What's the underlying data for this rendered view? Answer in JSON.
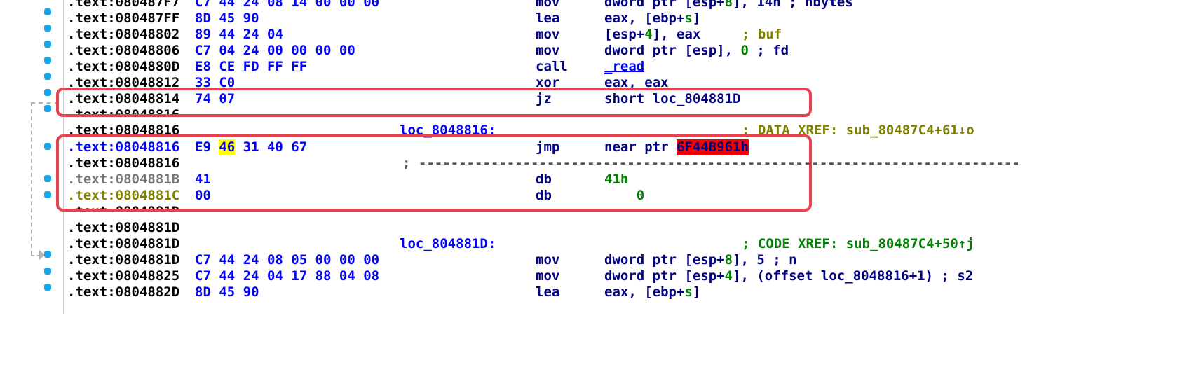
{
  "colors": {
    "address": "#000000",
    "bytes": "#0000ff",
    "mnemonic": "#000080",
    "comment": "#808000",
    "number": "#008000",
    "highlight_box": "#e8424f",
    "breakpoint_dot": "#19a6e8"
  },
  "lines": [
    {
      "addr": ".text:080487F7",
      "bytes": "C7 44 24 08 14 00 00 00",
      "label": "",
      "mnemonic": "mov",
      "operand_pre": "dword ptr [esp+",
      "operand_num": "8",
      "operand_post": "], 14h ; nbytes",
      "comment": ""
    },
    {
      "addr": ".text:080487FF",
      "bytes": "8D 45 90",
      "label": "",
      "mnemonic": "lea",
      "operand_pre": "eax, [ebp+",
      "operand_num": "s",
      "operand_post": "]",
      "comment": ""
    },
    {
      "addr": ".text:08048802",
      "bytes": "89 44 24 04",
      "label": "",
      "mnemonic": "mov",
      "operand_pre": "[esp+",
      "operand_num": "4",
      "operand_post": "], eax",
      "comment": "; buf"
    },
    {
      "addr": ".text:08048806",
      "bytes": "C7 04 24 00 00 00 00",
      "label": "",
      "mnemonic": "mov",
      "operand_pre": "dword ptr [esp], ",
      "operand_num": "0",
      "operand_post": " ; fd",
      "comment": ""
    },
    {
      "addr": ".text:0804880D",
      "bytes": "E8 CE FD FF FF",
      "label": "",
      "mnemonic": "call",
      "operand_pre": "_read",
      "operand_num": "",
      "operand_post": "",
      "comment": ""
    },
    {
      "addr": ".text:08048812",
      "bytes": "33 C0",
      "label": "",
      "mnemonic": "xor",
      "operand_pre": "eax, eax",
      "operand_num": "",
      "operand_post": "",
      "comment": ""
    },
    {
      "addr": ".text:08048814",
      "bytes": "74 07",
      "label": "",
      "mnemonic": "jz",
      "operand_pre": "short loc_804881D",
      "operand_num": "",
      "operand_post": "",
      "comment": ""
    },
    {
      "addr": ".text:08048816",
      "bytes": "",
      "label": "",
      "mnemonic": "",
      "operand_pre": "",
      "operand_num": "",
      "operand_post": "",
      "comment": ""
    },
    {
      "addr": ".text:08048816",
      "bytes": "",
      "label": "loc_8048816:",
      "mnemonic": "",
      "operand_pre": "",
      "operand_num": "",
      "operand_post": "",
      "comment": "; DATA XREF: sub_80487C4+61↓o"
    },
    {
      "addr": ".text:08048816",
      "bytes_pre": "E9 ",
      "bytes_hl": "46",
      "bytes_post": " 31 40 67",
      "label": "",
      "mnemonic": "jmp",
      "operand_pre": "near ptr ",
      "operand_hl": "6F44B961h",
      "comment": ""
    },
    {
      "addr": ".text:08048816",
      "sep": "; ---------------------------------------------------------------------------"
    },
    {
      "addr": ".text:0804881B",
      "bytes": "41",
      "label": "",
      "mnemonic": "db",
      "operand_pre": "",
      "operand_num": "41h",
      "operand_post": "",
      "comment": ""
    },
    {
      "addr": ".text:0804881C",
      "bytes": "00",
      "label": "",
      "mnemonic": "db",
      "operand_pre": "    ",
      "operand_num": "0",
      "operand_post": "",
      "comment": ""
    },
    {
      "addr": ".text:0804881D",
      "sep": "; ---------------------------------------------------------------------------"
    },
    {
      "addr": ".text:0804881D",
      "bytes": "",
      "label": "",
      "mnemonic": "",
      "operand_pre": "",
      "operand_num": "",
      "operand_post": "",
      "comment": ""
    },
    {
      "addr": ".text:0804881D",
      "bytes": "",
      "label": "loc_804881D:",
      "mnemonic": "",
      "operand_pre": "",
      "operand_num": "",
      "operand_post": "",
      "comment": "; CODE XREF: sub_80487C4+50↑j"
    },
    {
      "addr": ".text:0804881D",
      "bytes": "C7 44 24 08 05 00 00 00",
      "label": "",
      "mnemonic": "mov",
      "operand_pre": "dword ptr [esp+",
      "operand_num": "8",
      "operand_post": "], 5 ; n",
      "comment": ""
    },
    {
      "addr": ".text:08048825",
      "bytes": "C7 44 24 04 17 88 04 08",
      "label": "",
      "mnemonic": "mov",
      "operand_pre": "dword ptr [esp+",
      "operand_num": "4",
      "operand_post": "], (offset loc_8048816+1) ; s2",
      "comment": ""
    },
    {
      "addr": ".text:0804882D",
      "bytes": "8D 45 90",
      "label": "",
      "mnemonic": "lea",
      "operand_pre": "eax, [ebp+",
      "operand_num": "s",
      "operand_post": "]",
      "comment": ""
    }
  ]
}
